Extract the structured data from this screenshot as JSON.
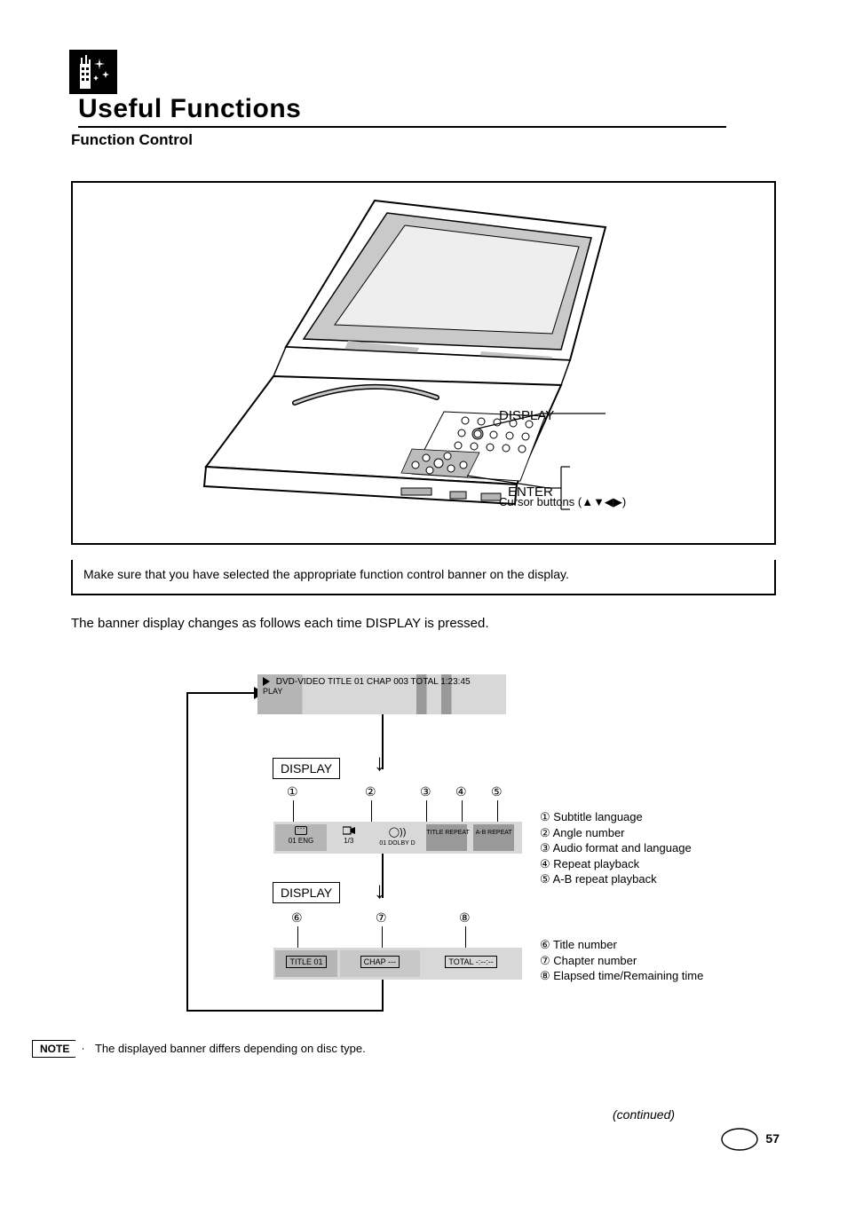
{
  "header": {
    "title": "Useful Functions"
  },
  "subtitle": "Function Control",
  "figure": {
    "callout_display": "DISPLAY",
    "callout_enter": "ENTER",
    "callout_cursor": "Cursor buttons (▲▼◀▶)",
    "caption": "Make sure that you have selected the appropriate function control banner on the display."
  },
  "banner": {
    "intro": "The banner display changes as follows each time DISPLAY is pressed.",
    "status1_line1": "    DVD-VIDEO  TITLE 01  CHAP 003  TOTAL 1:23:45",
    "status1_line2": "          PLAY",
    "label_display": "DISPLAY",
    "status2": {
      "subtitle": "01 ENG",
      "angle": "1/3",
      "audio": "01 DOLBY D",
      "title_repeat": "TITLE REPEAT",
      "ab_repeat": "A-B REPEAT"
    },
    "status3": {
      "seg1": "TITLE 01",
      "seg2": "CHAP ---",
      "seg3": "TOTAL -:--:--"
    }
  },
  "numbers": {
    "row1": {
      "n1": "①",
      "n2": "②",
      "n3": "③",
      "n4": "④",
      "n5": "⑤"
    },
    "row2": {
      "n6": "⑥",
      "n7": "⑦",
      "n8": "⑧"
    }
  },
  "legend": {
    "l1": "Subtitle language",
    "l2": "Angle number",
    "l3": "Audio format and language",
    "l4": "Repeat playback",
    "l5": "A-B repeat playback",
    "l6": "Title number",
    "l7": "Chapter number",
    "l8": "Elapsed time/Remaining time"
  },
  "note": {
    "label": "NOTE",
    "text": "The displayed banner differs depending on disc type."
  },
  "footer": {
    "continued": "(continued)",
    "page": "57"
  }
}
